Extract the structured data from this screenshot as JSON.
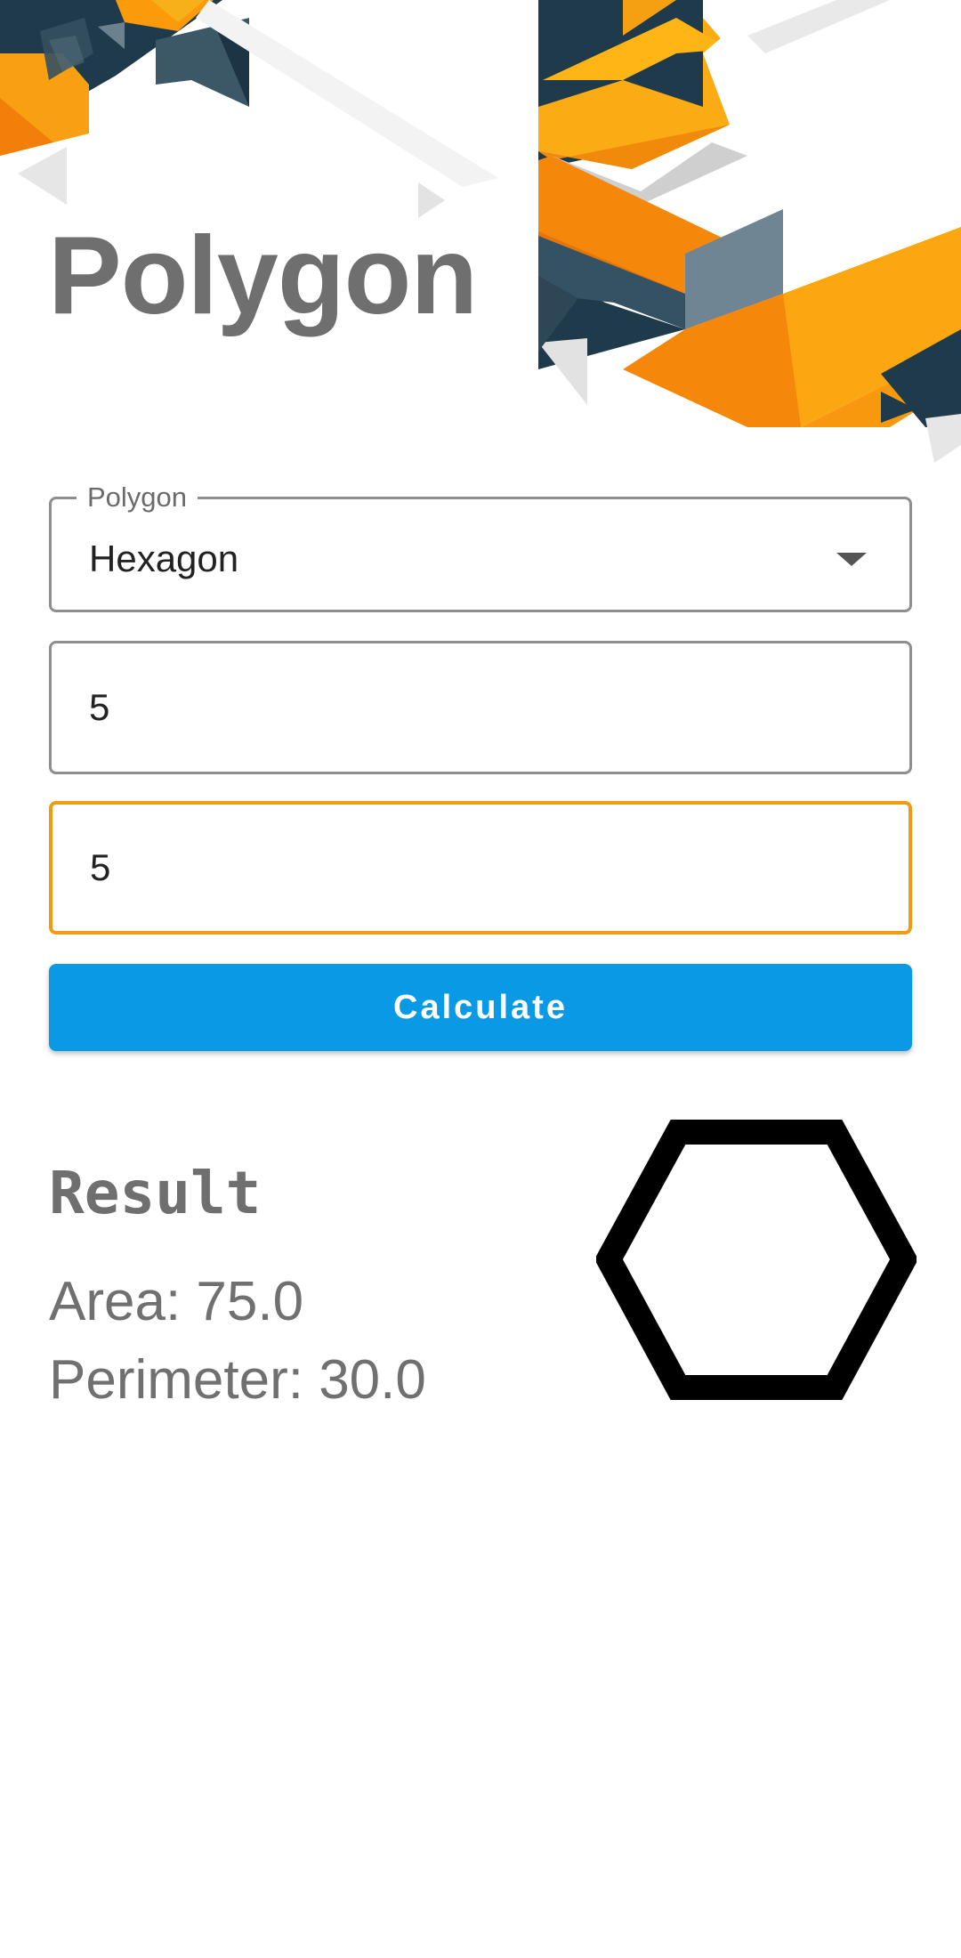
{
  "header": {
    "title": "Polygon"
  },
  "form": {
    "polygon_select": {
      "label": "Polygon",
      "value": "Hexagon"
    },
    "input_1": {
      "value": "5"
    },
    "input_2": {
      "value": "5",
      "focused": true
    },
    "calculate_label": "Calculate"
  },
  "result": {
    "heading": "Result",
    "area": "Area: 75.0",
    "perimeter": "Perimeter: 30.0",
    "shape_icon": "hexagon-icon"
  },
  "colors": {
    "accent_orange": "#f29b12",
    "button_blue": "#0a9ae5",
    "navy": "#1e3545",
    "slate": "#34505f",
    "gray_blue": "#6f8593",
    "title_gray": "#6f6f6f"
  }
}
